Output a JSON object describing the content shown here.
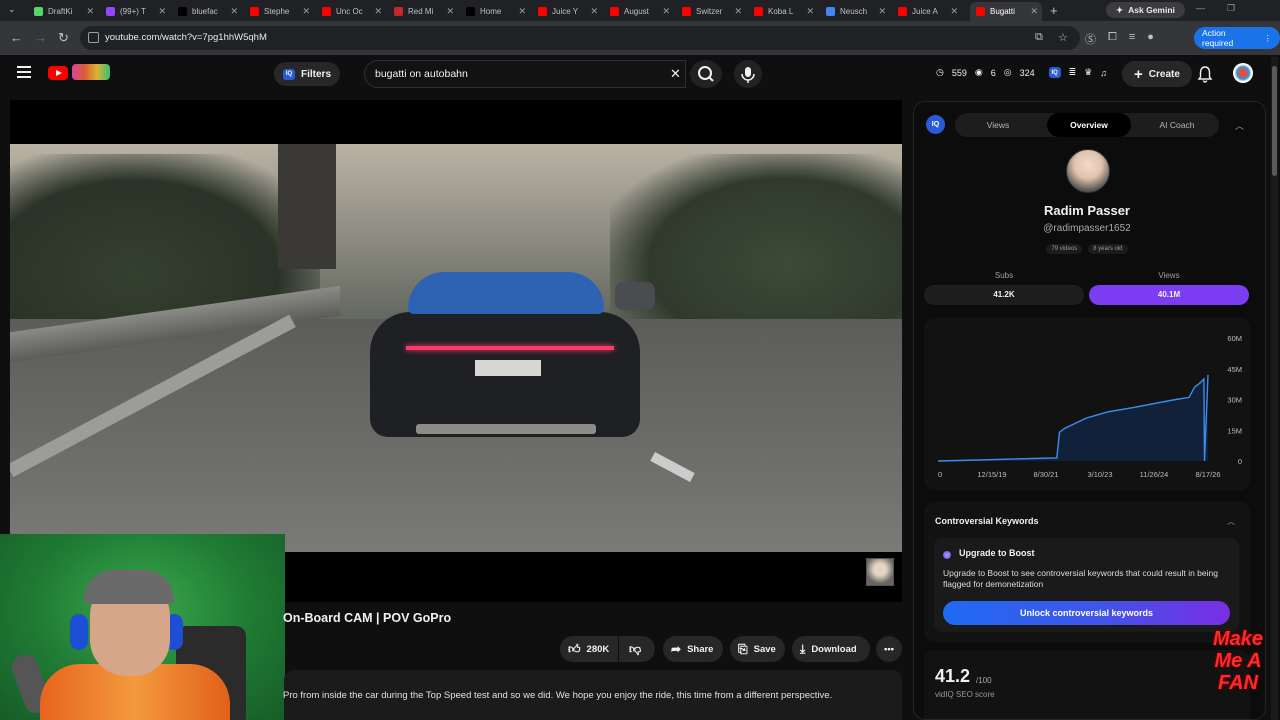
{
  "browser": {
    "tabs": [
      {
        "title": "DraftKi",
        "color": "#53d769"
      },
      {
        "title": "(99+) T",
        "color": "#9146ff"
      },
      {
        "title": "bluefac",
        "color": "#000000"
      },
      {
        "title": "Stephe",
        "color": "#ff0000"
      },
      {
        "title": "Unc Oc",
        "color": "#ff0000"
      },
      {
        "title": "Red Mi",
        "color": "#c62828"
      },
      {
        "title": "Home",
        "color": "#000000"
      },
      {
        "title": "Juice Y",
        "color": "#ff0000"
      },
      {
        "title": "August",
        "color": "#ff0000"
      },
      {
        "title": "Switzer",
        "color": "#ff0000"
      },
      {
        "title": "Koba L",
        "color": "#ff0000"
      },
      {
        "title": "Neusch",
        "color": "#4285f4"
      },
      {
        "title": "Juice A",
        "color": "#ff0000"
      },
      {
        "title": "Bugatti",
        "color": "#ff0000"
      }
    ],
    "gemini_label": "Ask Gemini",
    "url": "youtube.com/watch?v=7pg1hhW5qhM",
    "action_required": "Action required"
  },
  "header": {
    "filters_label": "Filters",
    "search_value": "bugatti on autobahn",
    "stats": {
      "clock": "559",
      "eye": "6",
      "views": "324"
    },
    "create_label": "Create"
  },
  "video": {
    "title": "On-Board CAM | POV GoPro",
    "actions": {
      "likes": "280K",
      "share": "Share",
      "save": "Save",
      "download": "Download"
    },
    "description": "Pro from inside the car during the Top Speed  test and so we did. We hope you enjoy the ride, this time from a different perspective."
  },
  "vidiq": {
    "badge": "IQ",
    "tabs": [
      "Views",
      "Overview",
      "AI Coach"
    ],
    "active_tab": "Overview",
    "channel": {
      "name": "Radim Passer",
      "handle": "@radimpasser1652",
      "videos": "79 videos",
      "age": "8 years old"
    },
    "subs_label": "Subs",
    "subs_value": "41.2K",
    "views_label": "Views",
    "views_value": "40.1M",
    "keywords": {
      "title": "Controversial Keywords",
      "upgrade_title": "Upgrade to Boost",
      "upgrade_body": "Upgrade to Boost to see controversial keywords that could result in being flagged for demonetization",
      "button": "Unlock controversial keywords"
    },
    "seo": {
      "score": "41.2",
      "max": "/100",
      "label": "vidIQ SEO score"
    }
  },
  "chart_data": {
    "type": "area",
    "title": "",
    "xlabel": "",
    "ylabel": "",
    "x_ticks": [
      "0",
      "12/15/19",
      "8/30/21",
      "3/10/23",
      "11/26/24",
      "8/17/26"
    ],
    "y_ticks": [
      "0",
      "15M",
      "30M",
      "45M",
      "60M"
    ],
    "ylim": [
      0,
      60
    ],
    "y_unit": "M",
    "series": [
      {
        "x": [
          0,
          0.15,
          0.35,
          0.44,
          0.45,
          0.47,
          0.55,
          0.63,
          0.72,
          0.8,
          0.88,
          0.93,
          0.95,
          0.97,
          0.985,
          0.987,
          1.0
        ],
        "values": [
          0,
          0.5,
          1.2,
          1.5,
          14,
          16,
          21,
          24,
          26,
          28,
          30,
          31,
          36,
          38,
          40,
          0,
          42
        ]
      }
    ],
    "colors": {
      "line": "#3b8ef0",
      "fill": "#12243f"
    }
  },
  "watermark": {
    "lines": [
      "Make",
      "Me A",
      "FAN"
    ]
  }
}
